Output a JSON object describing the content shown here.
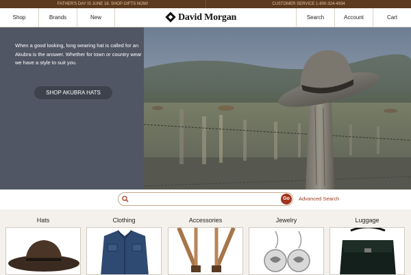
{
  "topbar": {
    "promo": "FATHER'S DAY IS JUNE 18.  SHOP GIFTS NOW!",
    "service": "CUSTOMER SERVICE  1-800-324-4934"
  },
  "nav": {
    "left": [
      "Shop",
      "Brands",
      "New"
    ],
    "logo_text": "David Morgan",
    "right": [
      "Search",
      "Account",
      "Cart"
    ]
  },
  "hero": {
    "text": "When a good looking, long wearing hat is called for an Akubra is the answer. Whether for town or country wear we have a style to suit you.",
    "button": "SHOP AKUBRA HATS"
  },
  "search": {
    "placeholder": "",
    "go_label": "Go",
    "advanced_label": "Advanced Search"
  },
  "categories": [
    "Hats",
    "Clothing",
    "Accessories",
    "Jewelry",
    "Luggage"
  ],
  "colors": {
    "topbar_bg": "#5b3a1f",
    "hero_panel": "#505663",
    "accent": "#a3351f"
  }
}
